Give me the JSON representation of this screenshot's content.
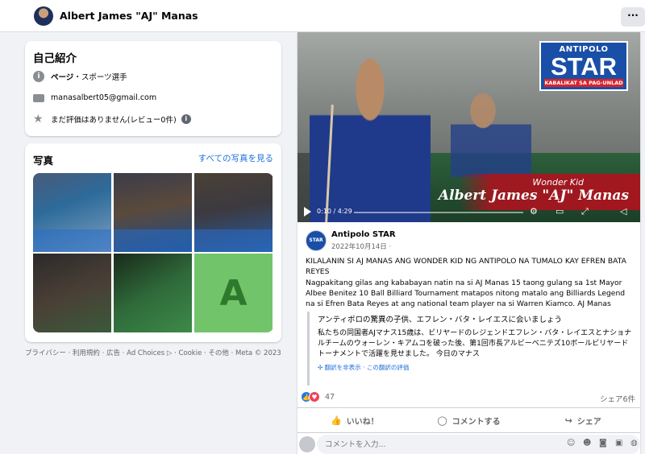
{
  "header": {
    "profile_name": "Albert James \"AJ\" Manas",
    "more_label": "···"
  },
  "intro": {
    "title": "自己紹介",
    "category_label": "ページ",
    "category_value": "・スポーツ選手",
    "email": "manasalbert05@gmail.com",
    "rating": "まだ評価はありません(レビュー0件)",
    "info_glyph": "i"
  },
  "photos": {
    "title": "写真",
    "see_all": "すべての写真を見る",
    "tile6_letter": "A"
  },
  "footer": "プライバシー · 利用規約 · 広告 · Ad Choices ▷ · Cookie · その他 · Meta © 2023",
  "post": {
    "video": {
      "logo_line1": "ANTIPOLO",
      "logo_line2": "STAR",
      "logo_line3": "KABALIKAT SA PAG-UNLAD",
      "banner_sub": "Wonder Kid",
      "banner_name": "Albert James \"AJ\" Manas",
      "time": "0:10 / 4:29"
    },
    "page_avatar_text": "STAR",
    "page_name": "Antipolo STAR",
    "date": "2022年10月14日 ·",
    "text1": "KILALANIN SI AJ MANAS ANG WONDER KID NG ANTIPOLO NA TUMALO KAY EFREN BATA REYES",
    "text2": "Nagpakitang gilas ang kababayan natin na si AJ Manas 15 taong gulang sa 1st Mayor Albee Benitez 10 Ball Billiard Tournament matapos nitong matalo ang Billiards Legend na si Efren Bata Reyes at ang national team player na si Warren Kiamco. AJ Manas",
    "translation": {
      "title": "アンティポロの驚異の子供、エフレン・バタ・レイエスに会いましょう",
      "body": "私たちの同国者AJマナス15歳は、ビリヤードのレジェンドエフレン・バタ・レイエスとナショナルチームのウォーレン・キアムコを破った後、第1回市長アルビーベニテズ10ボールビリヤードトーナメントで活躍を見せました。 今日のマナス",
      "link": "翻訳を非表示 · この翻訳の評価"
    },
    "reaction_count": "47",
    "shares": "シェア6件",
    "actions": {
      "like": "いいね！",
      "comment": "コメントする",
      "share": "シェア"
    },
    "comment_placeholder": "コメントを入力..."
  },
  "colors": {
    "accent": "#216fdb",
    "like_blue": "#1877f2",
    "heart_red": "#f33e58",
    "brand_blue": "#1a4fa8",
    "brand_red": "#d8232a"
  }
}
